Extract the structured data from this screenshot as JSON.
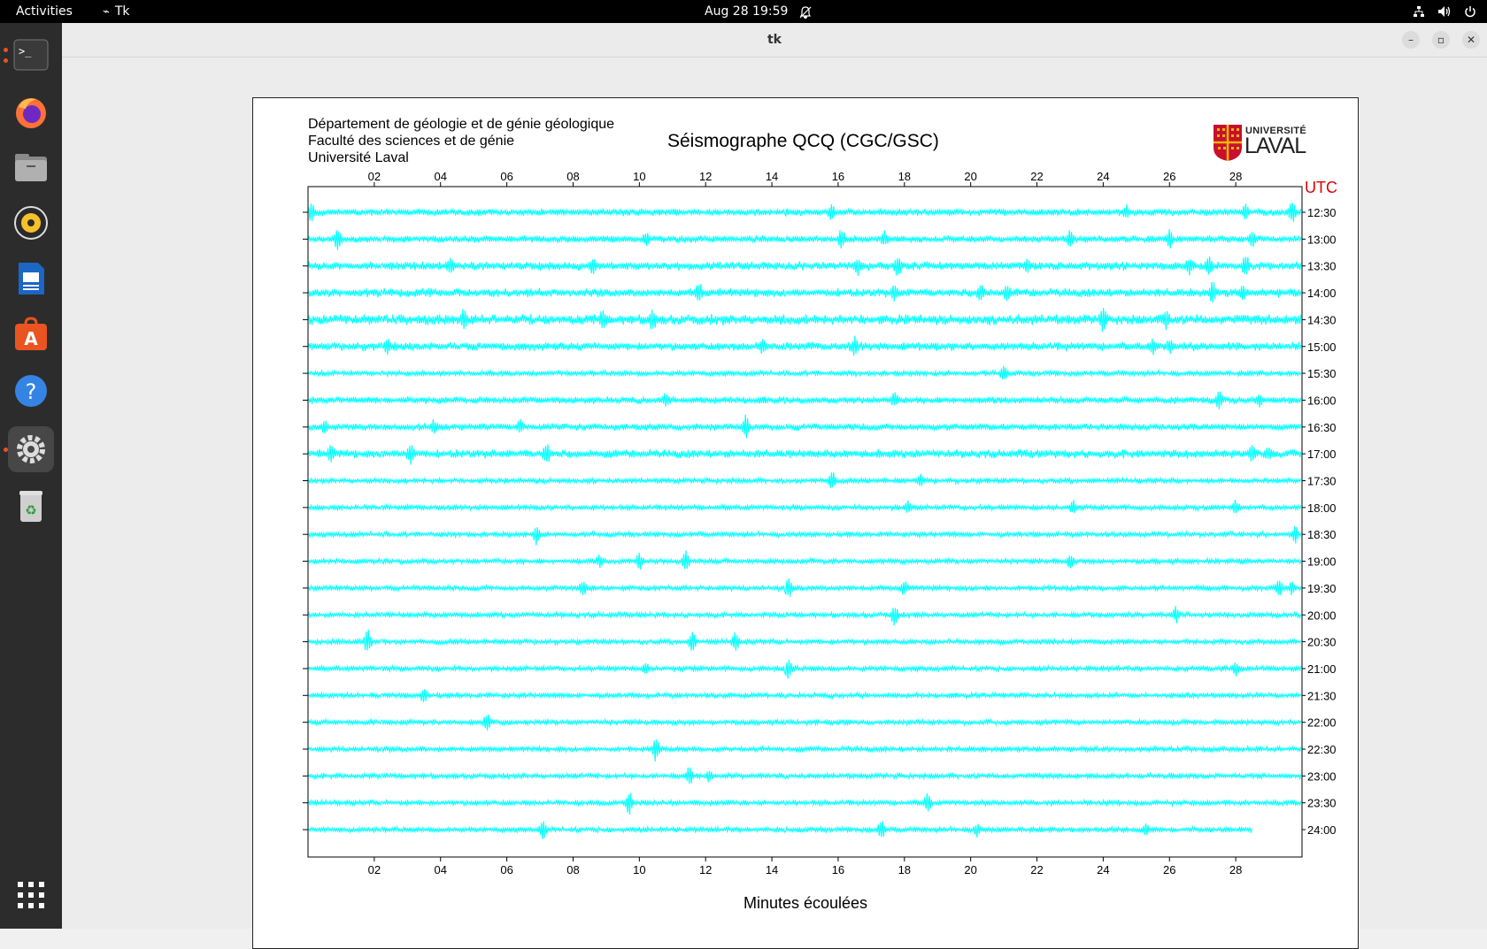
{
  "topbar": {
    "activities": "Activities",
    "app_name": "Tk",
    "clock": "Aug 28  19:59"
  },
  "window": {
    "title": "tk"
  },
  "plot": {
    "header_lines": [
      "Département de géologie et de génie géologique",
      "Faculté des sciences et de génie",
      "Université Laval"
    ],
    "title": "Séismographe QCQ (CGC/GSC)",
    "x_label": "Minutes écoulées",
    "utc_label": "UTC",
    "logo_line1": "UNIVERSITÉ",
    "logo_line2": "LAVAL"
  },
  "chart_data": {
    "type": "line",
    "title": "Séismographe QCQ (CGC/GSC)",
    "xlabel": "Minutes écoulées",
    "xlim": [
      0,
      30
    ],
    "x_ticks": [
      "02",
      "04",
      "06",
      "08",
      "10",
      "12",
      "14",
      "16",
      "18",
      "20",
      "22",
      "24",
      "26",
      "28"
    ],
    "trace_color": "#00ffff",
    "rows": [
      {
        "time": "12:30",
        "amp": 4,
        "spikes": [
          [
            0.1,
            10
          ],
          [
            15.8,
            9
          ],
          [
            24.7,
            8
          ],
          [
            28.3,
            9
          ],
          [
            29.7,
            13
          ]
        ]
      },
      {
        "time": "13:00",
        "amp": 4,
        "spikes": [
          [
            0.9,
            13
          ],
          [
            10.2,
            8
          ],
          [
            16.1,
            12
          ],
          [
            17.4,
            9
          ],
          [
            23,
            10
          ],
          [
            26,
            10
          ],
          [
            28.5,
            8
          ]
        ]
      },
      {
        "time": "13:30",
        "amp": 5,
        "spikes": [
          [
            4.3,
            9
          ],
          [
            8.6,
            10
          ],
          [
            16.6,
            9
          ],
          [
            17.8,
            12
          ],
          [
            21.7,
            8
          ],
          [
            26.6,
            10
          ],
          [
            27.2,
            12
          ],
          [
            28.3,
            13
          ]
        ]
      },
      {
        "time": "14:00",
        "amp": 5,
        "spikes": [
          [
            11.8,
            12
          ],
          [
            17.7,
            8
          ],
          [
            20.3,
            10
          ],
          [
            21.1,
            9
          ],
          [
            27.3,
            13
          ],
          [
            28.2,
            9
          ]
        ]
      },
      {
        "time": "14:30",
        "amp": 6,
        "spikes": [
          [
            4.7,
            12
          ],
          [
            8.9,
            10
          ],
          [
            10.4,
            12
          ],
          [
            24,
            14
          ],
          [
            25.9,
            9
          ]
        ]
      },
      {
        "time": "15:00",
        "amp": 5,
        "spikes": [
          [
            2.4,
            8
          ],
          [
            13.7,
            9
          ],
          [
            16.5,
            10
          ],
          [
            25.5,
            8
          ],
          [
            26,
            8
          ]
        ]
      },
      {
        "time": "15:30",
        "amp": 3,
        "spikes": [
          [
            21,
            10
          ]
        ]
      },
      {
        "time": "16:00",
        "amp": 4,
        "spikes": [
          [
            10.8,
            8
          ],
          [
            17.7,
            8
          ],
          [
            27.5,
            10
          ],
          [
            28.7,
            8
          ]
        ]
      },
      {
        "time": "16:30",
        "amp": 4,
        "spikes": [
          [
            0.5,
            9
          ],
          [
            3.8,
            8
          ],
          [
            6.4,
            8
          ],
          [
            13.2,
            14
          ]
        ]
      },
      {
        "time": "17:00",
        "amp": 5,
        "spikes": [
          [
            0.7,
            10
          ],
          [
            3.1,
            14
          ],
          [
            7.2,
            12
          ],
          [
            28.5,
            10
          ],
          [
            29,
            7
          ]
        ]
      },
      {
        "time": "17:30",
        "amp": 3,
        "spikes": [
          [
            15.8,
            13
          ],
          [
            18.5,
            7
          ]
        ]
      },
      {
        "time": "18:00",
        "amp": 3,
        "spikes": [
          [
            18.1,
            7
          ],
          [
            23.1,
            8
          ],
          [
            28,
            9
          ]
        ]
      },
      {
        "time": "18:30",
        "amp": 3,
        "spikes": [
          [
            6.9,
            12
          ],
          [
            29.8,
            10
          ]
        ]
      },
      {
        "time": "19:00",
        "amp": 3,
        "spikes": [
          [
            8.8,
            8
          ],
          [
            10,
            10
          ],
          [
            11.4,
            13
          ],
          [
            23,
            9
          ]
        ]
      },
      {
        "time": "19:30",
        "amp": 3,
        "spikes": [
          [
            8.3,
            10
          ],
          [
            14.5,
            12
          ],
          [
            18,
            9
          ],
          [
            29.3,
            11
          ],
          [
            29.7,
            8
          ]
        ]
      },
      {
        "time": "20:00",
        "amp": 3,
        "spikes": [
          [
            17.7,
            12
          ],
          [
            26.2,
            10
          ]
        ]
      },
      {
        "time": "20:30",
        "amp": 3,
        "spikes": [
          [
            1.8,
            15
          ],
          [
            11.6,
            12
          ],
          [
            12.9,
            12
          ]
        ]
      },
      {
        "time": "21:00",
        "amp": 3,
        "spikes": [
          [
            10.2,
            7
          ],
          [
            14.5,
            12
          ],
          [
            28,
            9
          ]
        ]
      },
      {
        "time": "21:30",
        "amp": 3,
        "spikes": [
          [
            3.5,
            10
          ]
        ]
      },
      {
        "time": "22:00",
        "amp": 3,
        "spikes": [
          [
            5.4,
            11
          ]
        ]
      },
      {
        "time": "22:30",
        "amp": 3,
        "spikes": [
          [
            10.5,
            16
          ]
        ]
      },
      {
        "time": "23:00",
        "amp": 3,
        "spikes": [
          [
            11.5,
            12
          ],
          [
            12.1,
            7
          ]
        ]
      },
      {
        "time": "23:30",
        "amp": 3,
        "spikes": [
          [
            9.7,
            15
          ],
          [
            18.7,
            12
          ]
        ]
      },
      {
        "time": "24:00",
        "amp": 3,
        "end": 28.5,
        "spikes": [
          [
            7.1,
            12
          ],
          [
            17.3,
            12
          ],
          [
            20.2,
            8
          ],
          [
            25.3,
            8
          ]
        ]
      }
    ]
  }
}
